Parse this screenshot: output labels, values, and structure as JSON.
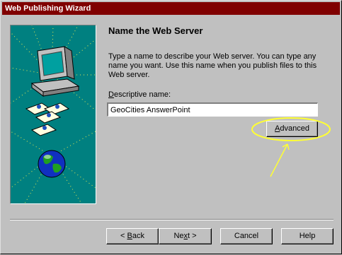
{
  "window": {
    "title": "Web Publishing Wizard"
  },
  "page": {
    "heading": "Name the Web Server",
    "description": "Type a name to describe your Web server. You can type any name you want. Use this name when you publish files to this Web server.",
    "field_label_accel": "D",
    "field_label_rest": "escriptive name:",
    "field_value": "GeoCities AnswerPoint"
  },
  "buttons": {
    "advanced_accel": "A",
    "advanced_rest": "dvanced",
    "back_prefix": "< ",
    "back_accel": "B",
    "back_rest": "ack",
    "next_prefix": "Ne",
    "next_accel": "x",
    "next_rest": "t >",
    "cancel": "Cancel",
    "help": "Help"
  },
  "colors": {
    "title_bar": "#800000",
    "panel": "#008080",
    "highlight": "#ffff33"
  }
}
